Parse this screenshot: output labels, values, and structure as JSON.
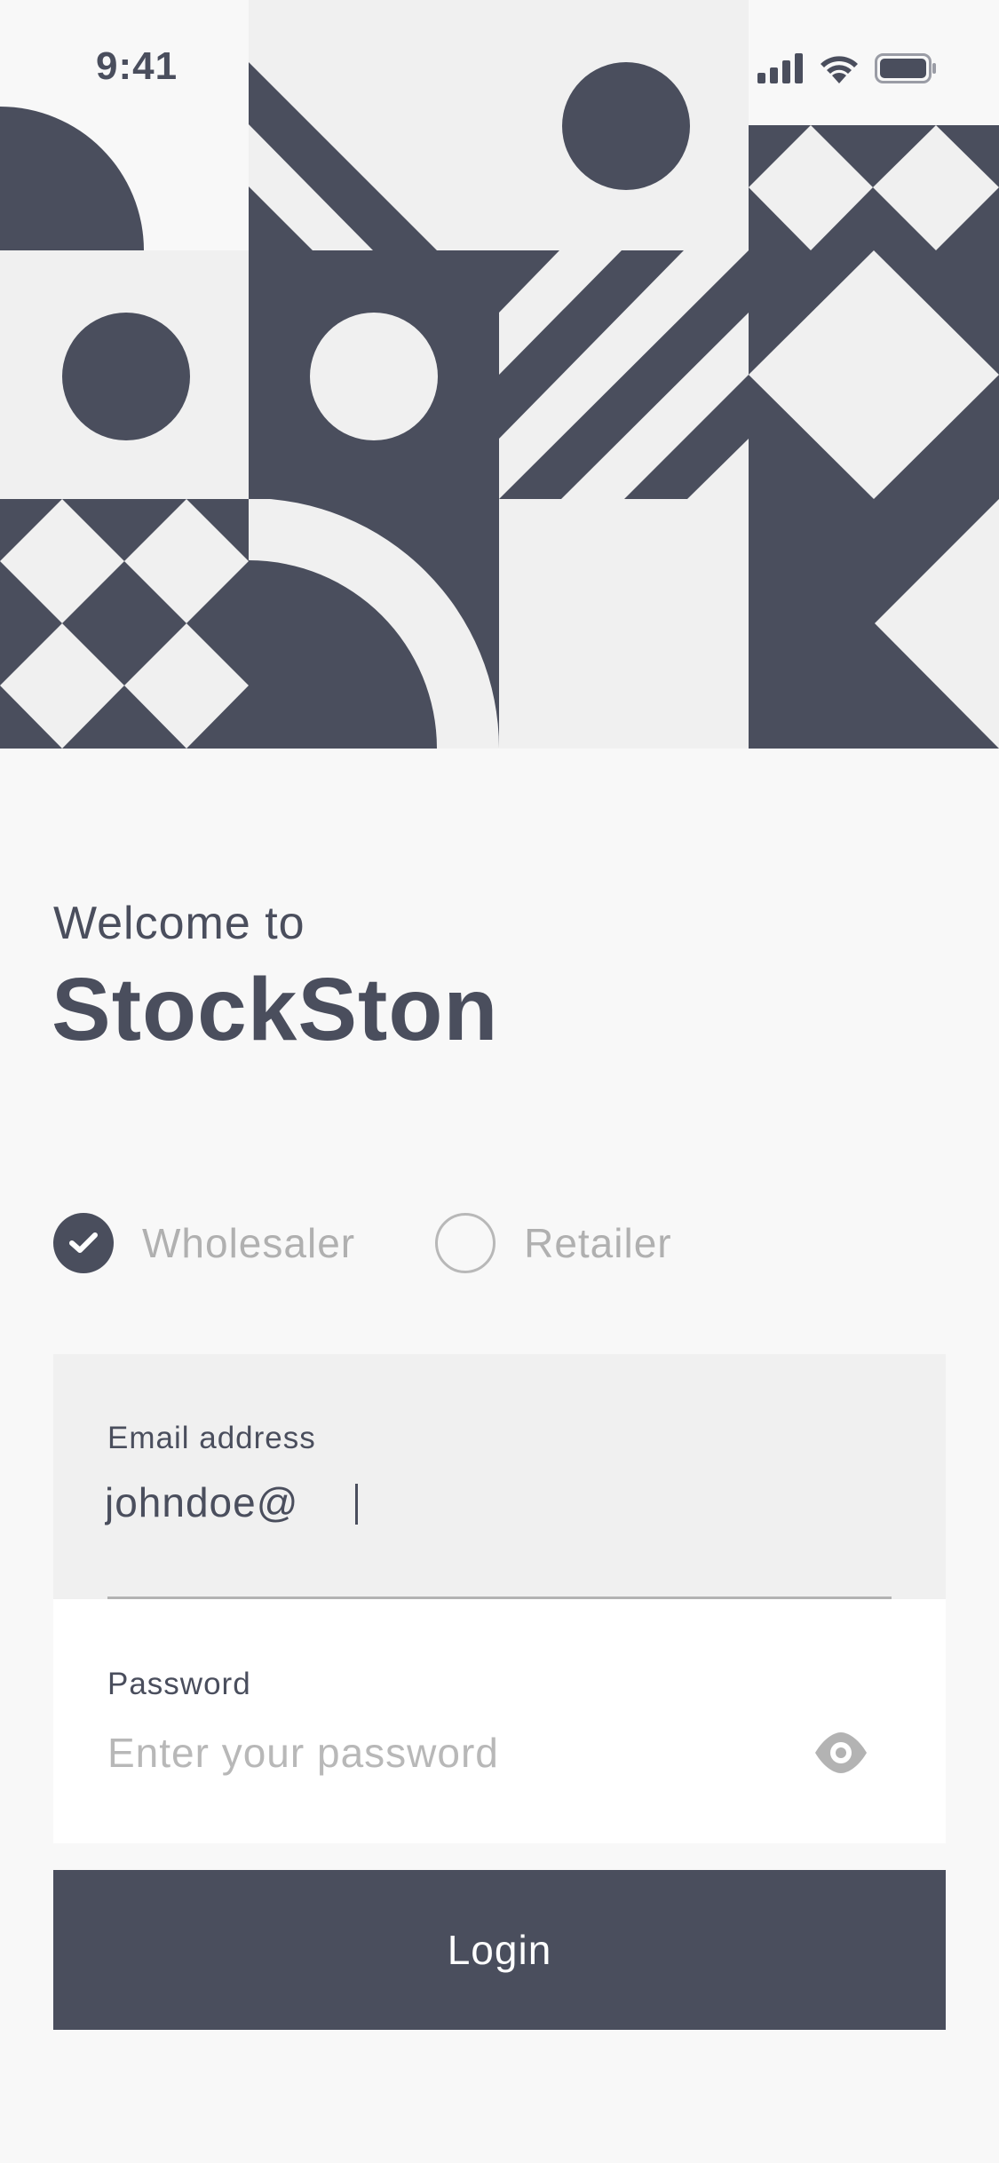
{
  "status_bar": {
    "time": "9:41",
    "icons": [
      "cellular-signal-icon",
      "wifi-icon",
      "battery-icon"
    ]
  },
  "hero": {
    "illustration": "geometric-pattern",
    "colors": {
      "dark": "#4a4e5d",
      "light": "#f0f0f0",
      "lighter": "#f8f8f8"
    }
  },
  "welcome": {
    "subtitle": "Welcome to",
    "brand": "StockSton"
  },
  "roles": [
    {
      "label": "Wholesaler",
      "selected": true
    },
    {
      "label": "Retailer",
      "selected": false
    }
  ],
  "email_field": {
    "label": "Email address",
    "value": "johndoe@"
  },
  "password_field": {
    "label": "Password",
    "placeholder": "Enter your password",
    "toggle_icon": "eye-icon"
  },
  "login_button": {
    "label": "Login"
  },
  "theme": {
    "primary": "#4a4e5d",
    "muted_text": "#b0b0b0",
    "background": "#f8f8f8"
  }
}
